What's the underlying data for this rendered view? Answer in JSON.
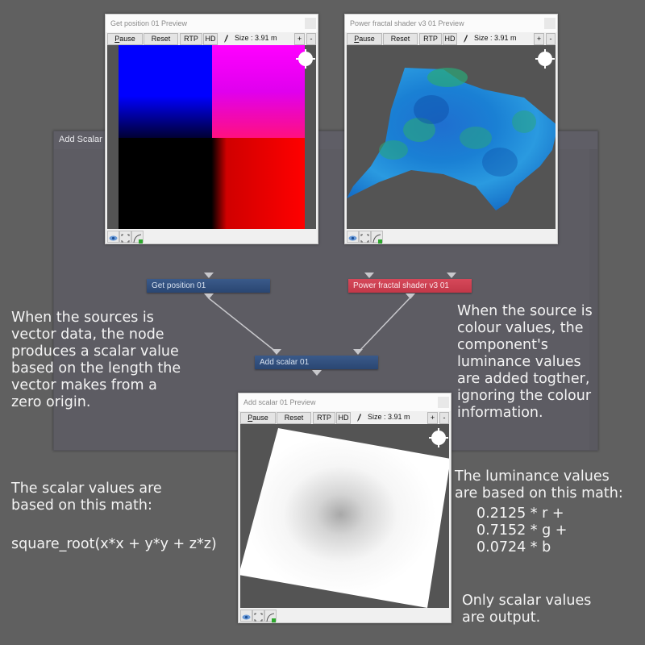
{
  "graph_panel": {
    "title": "Add Scalar"
  },
  "previews": [
    {
      "title": "Get position 01 Preview",
      "toolbar": {
        "pause": "Pause",
        "reset": "Reset",
        "rtp": "RTP",
        "hd": "HD",
        "size": "Size : 3.91 m",
        "plus": "+",
        "minus": "-"
      }
    },
    {
      "title": "Power fractal shader v3 01 Preview",
      "toolbar": {
        "pause": "Pause",
        "reset": "Reset",
        "rtp": "RTP",
        "hd": "HD",
        "size": "Size : 3.91 m",
        "plus": "+",
        "minus": "-"
      }
    },
    {
      "title": "Add scalar 01 Preview",
      "toolbar": {
        "pause": "Pause",
        "reset": "Reset",
        "rtp": "RTP",
        "hd": "HD",
        "size": "Size : 3.91 m",
        "plus": "+",
        "minus": "-"
      }
    }
  ],
  "nodes": {
    "get_position": "Get position 01",
    "power_fractal": "Power fractal shader v3 01",
    "add_scalar": "Add scalar 01"
  },
  "colors": {
    "node_blue": "#2f4d7c",
    "node_red": "#cf4152",
    "background": "#606060"
  },
  "notes": {
    "vector": "When the sources is\nvector data, the node\nproduces a scalar value\nbased on the length the\nvector makes from a\nzero origin.",
    "colour": "When the source is\ncolour values, the\ncomponent's\nluminance values\nare added togther,\nignoring the colour\ninformation.",
    "scalar_math_intro": "The scalar values are\nbased on this math:",
    "scalar_math_formula": "square_root(x*x + y*y + z*z)",
    "luminance_intro": "The luminance values\nare based on this math:",
    "luminance_formula": "0.2125 * r +\n0.7152 * g +\n0.0724 * b",
    "output": "Only scalar values\nare output."
  }
}
